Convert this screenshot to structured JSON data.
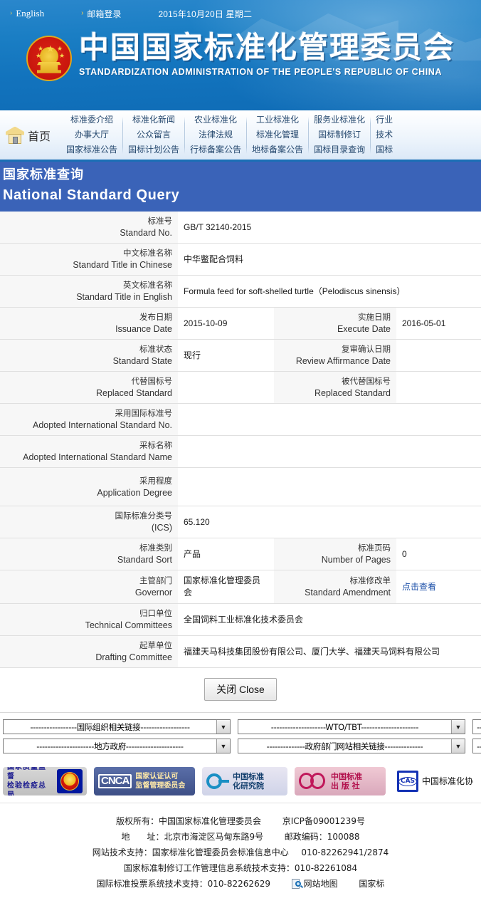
{
  "top_bar": {
    "english_link": "English",
    "mail_link": "邮箱登录",
    "date": "2015年10月20日  星期二",
    "arrow_glyph": "›"
  },
  "header": {
    "emblem": "national-emblem",
    "title_cn": "中国国家标准化管理委员会",
    "title_en": "STANDARDIZATION ADMINISTRATION OF THE PEOPLE'S REPUBLIC OF CHINA"
  },
  "nav": {
    "home_label": "首页",
    "columns": [
      {
        "items": [
          "标准委介绍",
          "办事大厅",
          "国家标准公告"
        ]
      },
      {
        "items": [
          "标准化新闻",
          "公众留言",
          "国标计划公告"
        ]
      },
      {
        "items": [
          "农业标准化",
          "法律法规",
          "行标备案公告"
        ]
      },
      {
        "items": [
          "工业标准化",
          "标准化管理",
          "地标备案公告"
        ]
      },
      {
        "items": [
          "服务业标准化",
          "国标制修订",
          "国标目录查询"
        ]
      },
      {
        "items": [
          "行业",
          "技术",
          "国标"
        ]
      }
    ]
  },
  "page_title": {
    "cn": "国家标准查询",
    "en": "National Standard Query"
  },
  "detail": {
    "rows": [
      {
        "label_cn": "标准号",
        "label_en": "Standard No.",
        "value": "GB/T 32140-2015",
        "span": true,
        "value_type": "text"
      },
      {
        "label_cn": "中文标准名称",
        "label_en": "Standard Title in Chinese",
        "value": "中华鳖配合饲料",
        "span": true,
        "value_type": "cn"
      },
      {
        "label_cn": "英文标准名称",
        "label_en": "Standard Title in English",
        "value": "Formula feed for soft-shelled turtle（Pelodiscus sinensis）",
        "span": true,
        "value_type": "text"
      },
      {
        "label_cn": "发布日期",
        "label_en": "Issuance Date",
        "value": "2015-10-09",
        "label2_cn": "实施日期",
        "label2_en": "Execute Date",
        "value2": "2016-05-01",
        "span": false
      },
      {
        "label_cn": "标准状态",
        "label_en": "Standard State",
        "value": "现行",
        "label2_cn": "复审确认日期",
        "label2_en": "Review Affirmance Date",
        "value2": "",
        "span": false,
        "value_type": "cn"
      },
      {
        "label_cn": "代替国标号",
        "label_en": "Replaced Standard",
        "value": "",
        "label2_cn": "被代替国标号",
        "label2_en": "Replaced Standard",
        "value2": "",
        "span": false
      },
      {
        "label_cn": "采用国际标准号",
        "label_en": "Adopted International Standard No.",
        "value": "",
        "span": true
      },
      {
        "label_cn": "采标名称",
        "label_en": "Adopted International Standard Name",
        "value": "",
        "span": true
      },
      {
        "label_cn": "采用程度",
        "label_en": "Application Degree",
        "value": "",
        "span": true,
        "tall": true
      },
      {
        "label_cn": "国际标准分类号",
        "label_en": "(ICS)",
        "value": "65.120",
        "span": true
      },
      {
        "label_cn": "标准类别",
        "label_en": "Standard Sort",
        "value": "产品",
        "label2_cn": "标准页码",
        "label2_en": "Number of Pages",
        "value2": "0",
        "span": false,
        "value_type": "cn"
      },
      {
        "label_cn": "主管部门",
        "label_en": "Governor",
        "value": "国家标准化管理委员会",
        "label2_cn": "标准修改单",
        "label2_en": "Standard Amendment",
        "value2": "点击查看",
        "value2_is_link": true,
        "span": false,
        "value_type": "cn"
      },
      {
        "label_cn": "归口单位",
        "label_en": "Technical Committees",
        "value": "全国饲料工业标准化技术委员会",
        "span": true,
        "value_type": "cn"
      },
      {
        "label_cn": "起草单位",
        "label_en": "Drafting Committee",
        "value": "福建天马科技集团股份有限公司、厦门大学、福建天马饲料有限公司",
        "span": true,
        "value_type": "cn"
      }
    ]
  },
  "close_button": {
    "label": "关闭 Close"
  },
  "selects": {
    "row1": [
      {
        "value": "-----------------国际组织相关链接------------------"
      },
      {
        "value": "--------------------WTO/TBT---------------------"
      },
      {
        "value": "--"
      }
    ],
    "row2": [
      {
        "value": "---------------------地方政府---------------------"
      },
      {
        "value": "--------------政府部门网站相关链接--------------"
      },
      {
        "value": "--"
      }
    ],
    "arrow_glyph": "▼"
  },
  "logos": [
    {
      "name": "aqsiq-logo",
      "text": "国家质量监督\n检验检疫总局",
      "line1": "国家质量监督",
      "line2": "检验检疫总局"
    },
    {
      "name": "cnca-logo",
      "mark": "CNCA",
      "line1": "国家认证认可",
      "line2": "监督管理委员会"
    },
    {
      "name": "cnis-logo",
      "mark": "NIS",
      "line1": "中国标准",
      "line2": "化研究院"
    },
    {
      "name": "standards-press-logo",
      "line1": "中国标准",
      "line2": "出 版 社"
    },
    {
      "name": "cas-logo",
      "mark": "CAS",
      "line1": "中国标准化协"
    }
  ],
  "footer": {
    "line1_a": "版权所有：中国国家标准化管理委员会",
    "line1_b": "京ICP备09001239号",
    "line2_a": "地　　址：北京市海淀区马甸东路9号",
    "line2_b": "邮政编码：100088",
    "line3_a": "网站技术支持：国家标准化管理委员会标准信息中心",
    "line3_b": "010-82262941/2874",
    "line4": "国家标准制修订工作管理信息系统技术支持：010-82261084",
    "line5_a": "国际标准投票系统技术支持：010-82262629",
    "line5_b": "网站地图",
    "line5_c": "国家标"
  }
}
